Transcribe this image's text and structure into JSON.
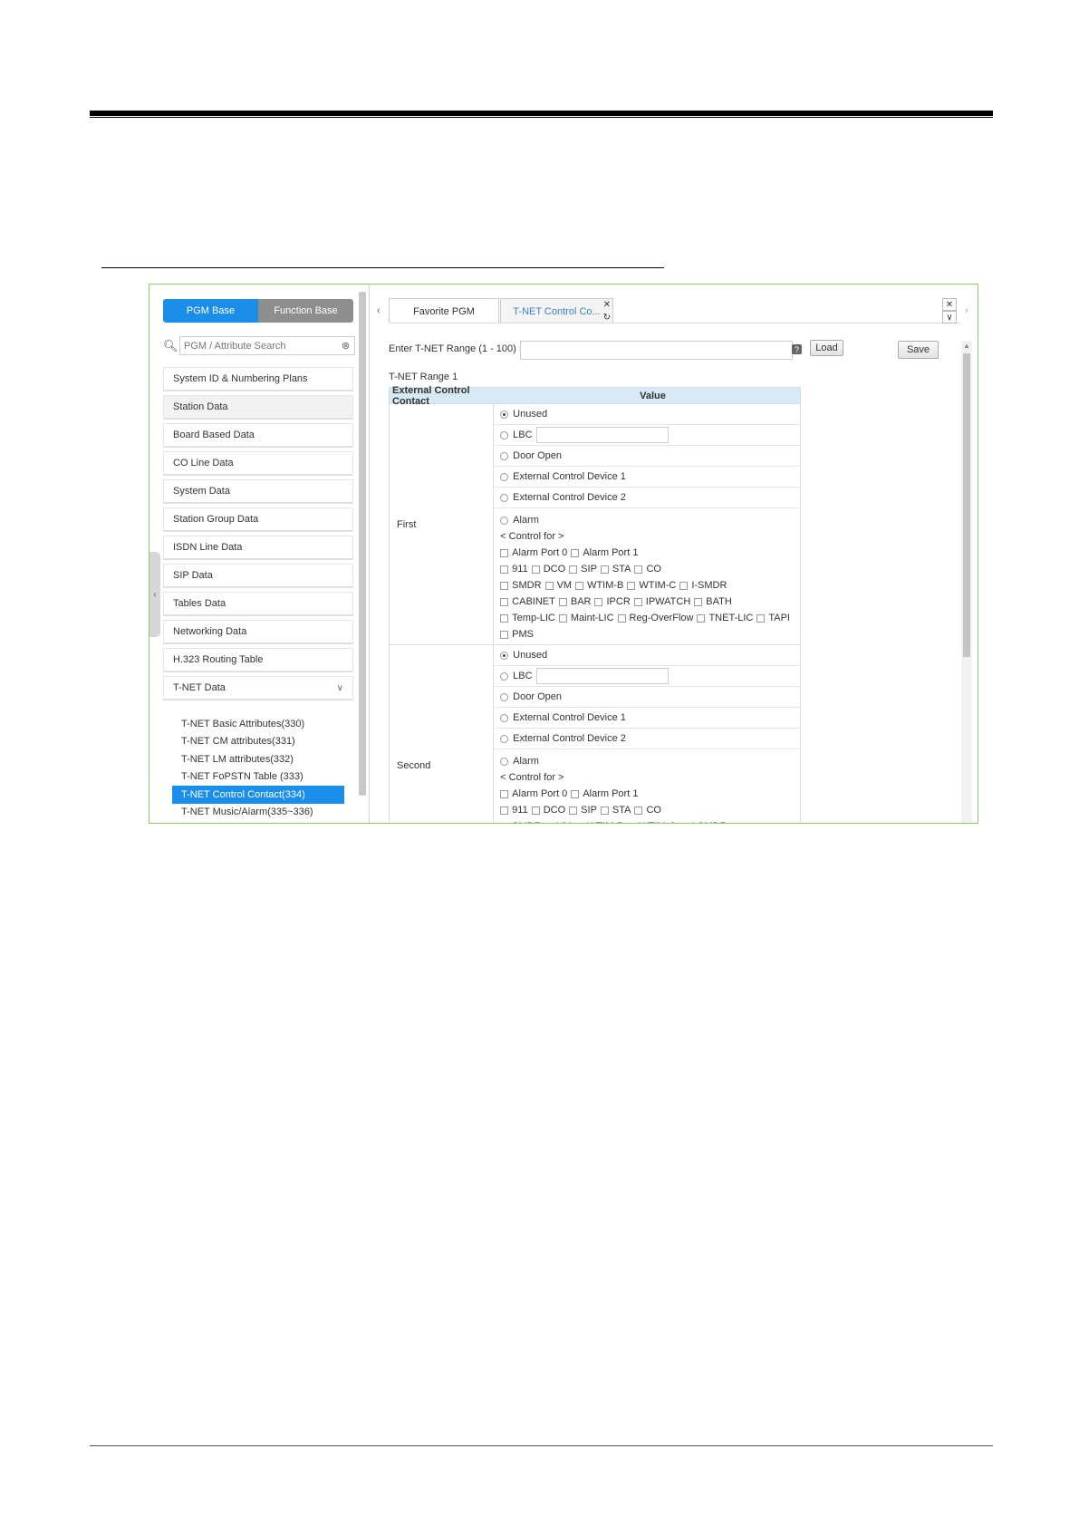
{
  "sidebar": {
    "pgm_base": "PGM Base",
    "function_base": "Function Base",
    "search_placeholder": "PGM / Attribute Search",
    "items": [
      {
        "label": "System ID & Numbering Plans"
      },
      {
        "label": "Station Data"
      },
      {
        "label": "Board Based Data"
      },
      {
        "label": "CO Line Data"
      },
      {
        "label": "System Data"
      },
      {
        "label": "Station Group Data"
      },
      {
        "label": "ISDN Line Data"
      },
      {
        "label": "SIP Data"
      },
      {
        "label": "Tables Data"
      },
      {
        "label": "Networking Data"
      },
      {
        "label": "H.323 Routing Table"
      },
      {
        "label": "T-NET Data"
      }
    ],
    "subitems": [
      {
        "label": "T-NET Basic Attributes(330)"
      },
      {
        "label": "T-NET CM attributes(331)"
      },
      {
        "label": "T-NET LM attributes(332)"
      },
      {
        "label": "T-NET FoPSTN Table (333)"
      },
      {
        "label": "T-NET Control Contact(334)"
      },
      {
        "label": "T-NET Music/Alarm(335~336)"
      }
    ],
    "active_subitem": "T-NET Control Contact(334)"
  },
  "tabs": {
    "favorite": "Favorite PGM",
    "active": "T-NET Control Co..."
  },
  "form": {
    "range_label": "Enter T-NET Range (1 - 100) :",
    "range_value": "",
    "help": "?",
    "load": "Load",
    "save": "Save",
    "range_title": "T-NET Range 1"
  },
  "table": {
    "col1": "External Control Contact",
    "col2": "Value",
    "options": {
      "unused": "Unused",
      "lbc": "LBC",
      "door_open": "Door Open",
      "ecd1": "External Control Device 1",
      "ecd2": "External Control Device 2",
      "alarm": "Alarm",
      "control_for": "< Control for >"
    },
    "checkbox_rows": [
      [
        "Alarm Port 0",
        "Alarm Port 1"
      ],
      [
        "911",
        "DCO",
        "SIP",
        "STA",
        "CO"
      ],
      [
        "SMDR",
        "VM",
        "WTIM-B",
        "WTIM-C",
        "I-SMDR"
      ],
      [
        "CABINET",
        "BAR",
        "IPCR",
        "IPWATCH",
        "BATH"
      ],
      [
        "Temp-LIC",
        "Maint-LIC",
        "Reg-OverFlow",
        "TNET-LIC",
        "TAPI"
      ],
      [
        "PMS"
      ]
    ],
    "groups": [
      {
        "label": "First",
        "selected": "unused"
      },
      {
        "label": "Second",
        "selected": "unused"
      }
    ]
  }
}
